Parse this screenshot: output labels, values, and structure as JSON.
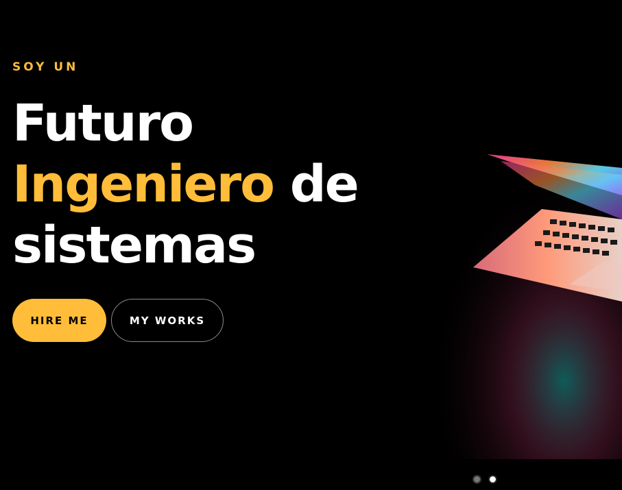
{
  "hero": {
    "eyebrow": "SOY UN",
    "headline": {
      "line1": "Futuro",
      "line2_accent": "Ingeniero",
      "line2_rest": " de",
      "line3": "sistemas"
    },
    "buttons": {
      "hire_label": "HIRE ME",
      "works_label": "MY WORKS"
    },
    "slider": {
      "slide_count": 2,
      "active_index": 1
    }
  },
  "colors": {
    "background": "#000000",
    "accent": "#ffbd39",
    "text": "#ffffff"
  },
  "icons": {
    "hero_image": "laptop-photo"
  }
}
